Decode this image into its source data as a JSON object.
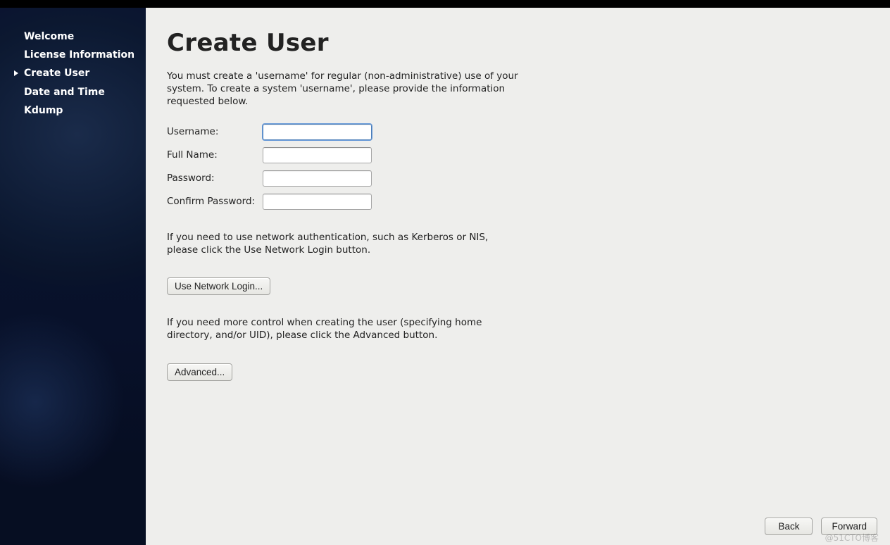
{
  "sidebar": {
    "items": [
      {
        "label": "Welcome",
        "active": false
      },
      {
        "label": "License Information",
        "active": false
      },
      {
        "label": "Create User",
        "active": true
      },
      {
        "label": "Date and Time",
        "active": false
      },
      {
        "label": "Kdump",
        "active": false
      }
    ]
  },
  "page": {
    "title": "Create User",
    "intro": "You must create a 'username' for regular (non-administrative) use of your system.  To create a system 'username', please provide the information requested below.",
    "network_note": "If you need to use network authentication, such as Kerberos or NIS, please click the Use Network Login button.",
    "advanced_note": "If you need more control when creating the user (specifying home directory, and/or UID), please click the Advanced button."
  },
  "form": {
    "username": {
      "label": "Username:",
      "value": ""
    },
    "fullname": {
      "label": "Full Name:",
      "value": ""
    },
    "password": {
      "label": "Password:",
      "value": ""
    },
    "confirm": {
      "label": "Confirm Password:",
      "value": ""
    }
  },
  "buttons": {
    "network_login": "Use Network Login...",
    "advanced": "Advanced...",
    "back": "Back",
    "forward": "Forward"
  },
  "watermark": "@51CTO博客"
}
